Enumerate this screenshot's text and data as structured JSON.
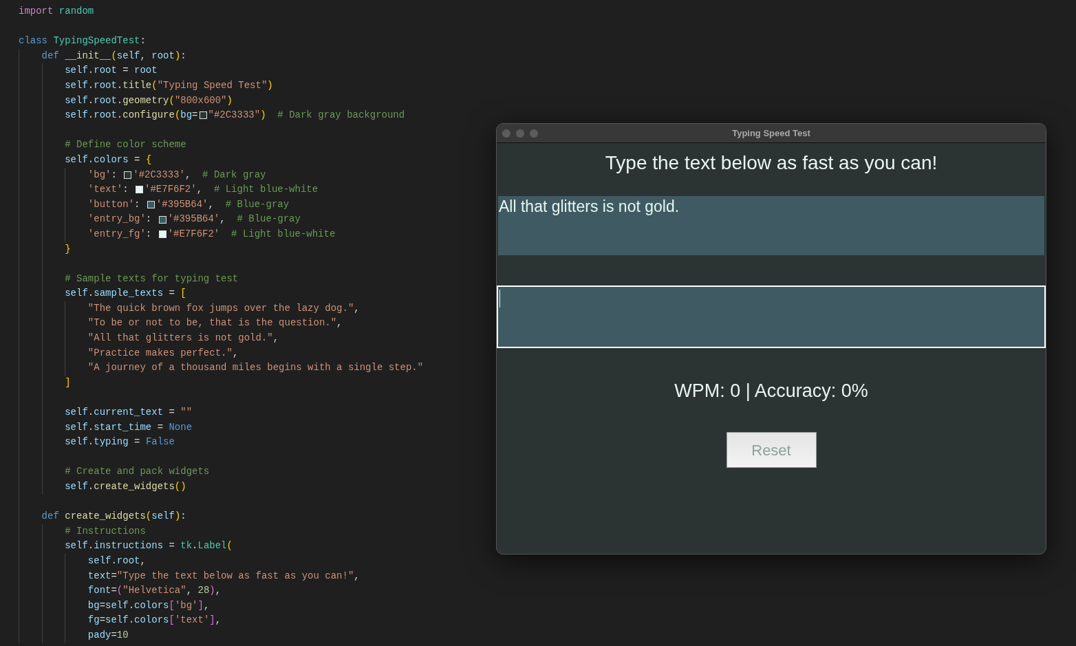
{
  "editor": {
    "lines": [
      {
        "tokens": [
          {
            "kind": "kw",
            "text": "import "
          },
          {
            "kind": "cls",
            "text": "random"
          }
        ]
      },
      {
        "kind": "blank"
      },
      {
        "tokens": [
          {
            "kind": "kw2",
            "text": "class "
          },
          {
            "kind": "cls",
            "text": "TypingSpeedTest"
          },
          {
            "kind": "plain",
            "text": ":"
          }
        ]
      },
      {
        "tokens": [
          {
            "kind": "kw2",
            "text": "    def "
          },
          {
            "kind": "fn",
            "text": "__init__"
          },
          {
            "kind": "br",
            "text": "("
          },
          {
            "kind": "var",
            "text": "self"
          },
          {
            "kind": "plain",
            "text": ", "
          },
          {
            "kind": "var",
            "text": "root"
          },
          {
            "kind": "br",
            "text": ")"
          },
          {
            "kind": "plain",
            "text": ":"
          }
        ]
      },
      {
        "tokens": [
          {
            "kind": "var",
            "text": "        self"
          },
          {
            "kind": "plain",
            "text": "."
          },
          {
            "kind": "var",
            "text": "root"
          },
          {
            "kind": "plain",
            "text": " = "
          },
          {
            "kind": "var",
            "text": "root"
          }
        ]
      },
      {
        "tokens": [
          {
            "kind": "var",
            "text": "        self"
          },
          {
            "kind": "plain",
            "text": "."
          },
          {
            "kind": "var",
            "text": "root"
          },
          {
            "kind": "plain",
            "text": "."
          },
          {
            "kind": "fn",
            "text": "title"
          },
          {
            "kind": "br",
            "text": "("
          },
          {
            "kind": "str",
            "text": "\"Typing Speed Test\""
          },
          {
            "kind": "br",
            "text": ")"
          }
        ]
      },
      {
        "tokens": [
          {
            "kind": "var",
            "text": "        self"
          },
          {
            "kind": "plain",
            "text": "."
          },
          {
            "kind": "var",
            "text": "root"
          },
          {
            "kind": "plain",
            "text": "."
          },
          {
            "kind": "fn",
            "text": "geometry"
          },
          {
            "kind": "br",
            "text": "("
          },
          {
            "kind": "str",
            "text": "\"800x600\""
          },
          {
            "kind": "br",
            "text": ")"
          }
        ]
      },
      {
        "tokens": [
          {
            "kind": "var",
            "text": "        self"
          },
          {
            "kind": "plain",
            "text": "."
          },
          {
            "kind": "var",
            "text": "root"
          },
          {
            "kind": "plain",
            "text": "."
          },
          {
            "kind": "fn",
            "text": "configure"
          },
          {
            "kind": "br",
            "text": "("
          },
          {
            "kind": "var",
            "text": "bg"
          },
          {
            "kind": "plain",
            "text": "="
          },
          {
            "kind": "swatch",
            "color": "#2c3333"
          },
          {
            "kind": "str",
            "text": "\"#2C3333\""
          },
          {
            "kind": "br",
            "text": ")"
          },
          {
            "kind": "com",
            "text": "  # Dark gray background"
          }
        ]
      },
      {
        "kind": "blank"
      },
      {
        "tokens": [
          {
            "kind": "com",
            "text": "        # Define color scheme"
          }
        ]
      },
      {
        "tokens": [
          {
            "kind": "var",
            "text": "        self"
          },
          {
            "kind": "plain",
            "text": "."
          },
          {
            "kind": "var",
            "text": "colors"
          },
          {
            "kind": "plain",
            "text": " = "
          },
          {
            "kind": "br",
            "text": "{"
          }
        ]
      },
      {
        "tokens": [
          {
            "kind": "str",
            "text": "            'bg'"
          },
          {
            "kind": "plain",
            "text": ": "
          },
          {
            "kind": "swatch",
            "color": "#2c3333"
          },
          {
            "kind": "str",
            "text": "'#2C3333'"
          },
          {
            "kind": "plain",
            "text": ",  "
          },
          {
            "kind": "com",
            "text": "# Dark gray"
          }
        ]
      },
      {
        "tokens": [
          {
            "kind": "str",
            "text": "            'text'"
          },
          {
            "kind": "plain",
            "text": ": "
          },
          {
            "kind": "swatch",
            "color": "#e7f6f2"
          },
          {
            "kind": "str",
            "text": "'#E7F6F2'"
          },
          {
            "kind": "plain",
            "text": ",  "
          },
          {
            "kind": "com",
            "text": "# Light blue-white"
          }
        ]
      },
      {
        "tokens": [
          {
            "kind": "str",
            "text": "            'button'"
          },
          {
            "kind": "plain",
            "text": ": "
          },
          {
            "kind": "swatch",
            "color": "#395b64"
          },
          {
            "kind": "str",
            "text": "'#395B64'"
          },
          {
            "kind": "plain",
            "text": ",  "
          },
          {
            "kind": "com",
            "text": "# Blue-gray"
          }
        ]
      },
      {
        "tokens": [
          {
            "kind": "str",
            "text": "            'entry_bg'"
          },
          {
            "kind": "plain",
            "text": ": "
          },
          {
            "kind": "swatch",
            "color": "#395b64"
          },
          {
            "kind": "str",
            "text": "'#395B64'"
          },
          {
            "kind": "plain",
            "text": ",  "
          },
          {
            "kind": "com",
            "text": "# Blue-gray"
          }
        ]
      },
      {
        "tokens": [
          {
            "kind": "str",
            "text": "            'entry_fg'"
          },
          {
            "kind": "plain",
            "text": ": "
          },
          {
            "kind": "swatch",
            "color": "#e7f6f2"
          },
          {
            "kind": "str",
            "text": "'#E7F6F2'"
          },
          {
            "kind": "com",
            "text": "  # Light blue-white"
          }
        ]
      },
      {
        "tokens": [
          {
            "kind": "br",
            "text": "        }"
          }
        ]
      },
      {
        "kind": "blank"
      },
      {
        "tokens": [
          {
            "kind": "com",
            "text": "        # Sample texts for typing test"
          }
        ]
      },
      {
        "tokens": [
          {
            "kind": "var",
            "text": "        self"
          },
          {
            "kind": "plain",
            "text": "."
          },
          {
            "kind": "var",
            "text": "sample_texts"
          },
          {
            "kind": "plain",
            "text": " = "
          },
          {
            "kind": "br",
            "text": "["
          }
        ]
      },
      {
        "tokens": [
          {
            "kind": "str",
            "text": "            \"The quick brown fox jumps over the lazy dog.\""
          },
          {
            "kind": "plain",
            "text": ","
          }
        ]
      },
      {
        "tokens": [
          {
            "kind": "str",
            "text": "            \"To be or not to be, that is the question.\""
          },
          {
            "kind": "plain",
            "text": ","
          }
        ]
      },
      {
        "tokens": [
          {
            "kind": "str",
            "text": "            \"All that glitters is not gold.\""
          },
          {
            "kind": "plain",
            "text": ","
          }
        ]
      },
      {
        "tokens": [
          {
            "kind": "str",
            "text": "            \"Practice makes perfect.\""
          },
          {
            "kind": "plain",
            "text": ","
          }
        ]
      },
      {
        "tokens": [
          {
            "kind": "str",
            "text": "            \"A journey of a thousand miles begins with a single step.\""
          }
        ]
      },
      {
        "tokens": [
          {
            "kind": "br",
            "text": "        ]"
          }
        ]
      },
      {
        "kind": "blank"
      },
      {
        "tokens": [
          {
            "kind": "var",
            "text": "        self"
          },
          {
            "kind": "plain",
            "text": "."
          },
          {
            "kind": "var",
            "text": "current_text"
          },
          {
            "kind": "plain",
            "text": " = "
          },
          {
            "kind": "str",
            "text": "\"\""
          }
        ]
      },
      {
        "tokens": [
          {
            "kind": "var",
            "text": "        self"
          },
          {
            "kind": "plain",
            "text": "."
          },
          {
            "kind": "var",
            "text": "start_time"
          },
          {
            "kind": "plain",
            "text": " = "
          },
          {
            "kind": "kw2",
            "text": "None"
          }
        ]
      },
      {
        "tokens": [
          {
            "kind": "var",
            "text": "        self"
          },
          {
            "kind": "plain",
            "text": "."
          },
          {
            "kind": "var",
            "text": "typing"
          },
          {
            "kind": "plain",
            "text": " = "
          },
          {
            "kind": "kw2",
            "text": "False"
          }
        ]
      },
      {
        "kind": "blank"
      },
      {
        "tokens": [
          {
            "kind": "com",
            "text": "        # Create and pack widgets"
          }
        ]
      },
      {
        "tokens": [
          {
            "kind": "var",
            "text": "        self"
          },
          {
            "kind": "plain",
            "text": "."
          },
          {
            "kind": "fn",
            "text": "create_widgets"
          },
          {
            "kind": "br",
            "text": "()"
          }
        ]
      },
      {
        "kind": "blank"
      },
      {
        "tokens": [
          {
            "kind": "kw2",
            "text": "    def "
          },
          {
            "kind": "fn",
            "text": "create_widgets"
          },
          {
            "kind": "br",
            "text": "("
          },
          {
            "kind": "var",
            "text": "self"
          },
          {
            "kind": "br",
            "text": ")"
          },
          {
            "kind": "plain",
            "text": ":"
          }
        ]
      },
      {
        "tokens": [
          {
            "kind": "com",
            "text": "        # Instructions"
          }
        ]
      },
      {
        "tokens": [
          {
            "kind": "var",
            "text": "        self"
          },
          {
            "kind": "plain",
            "text": "."
          },
          {
            "kind": "var",
            "text": "instructions"
          },
          {
            "kind": "plain",
            "text": " = "
          },
          {
            "kind": "cls",
            "text": "tk"
          },
          {
            "kind": "plain",
            "text": "."
          },
          {
            "kind": "cls",
            "text": "Label"
          },
          {
            "kind": "br",
            "text": "("
          }
        ]
      },
      {
        "tokens": [
          {
            "kind": "var",
            "text": "            self"
          },
          {
            "kind": "plain",
            "text": "."
          },
          {
            "kind": "var",
            "text": "root"
          },
          {
            "kind": "plain",
            "text": ","
          }
        ]
      },
      {
        "tokens": [
          {
            "kind": "var",
            "text": "            text"
          },
          {
            "kind": "plain",
            "text": "="
          },
          {
            "kind": "str",
            "text": "\"Type the text below as fast as you can!\""
          },
          {
            "kind": "plain",
            "text": ","
          }
        ]
      },
      {
        "tokens": [
          {
            "kind": "var",
            "text": "            font"
          },
          {
            "kind": "plain",
            "text": "="
          },
          {
            "kind": "br2",
            "text": "("
          },
          {
            "kind": "str",
            "text": "\"Helvetica\""
          },
          {
            "kind": "plain",
            "text": ", "
          },
          {
            "kind": "num",
            "text": "28"
          },
          {
            "kind": "br2",
            "text": ")"
          },
          {
            "kind": "plain",
            "text": ","
          }
        ]
      },
      {
        "tokens": [
          {
            "kind": "var",
            "text": "            bg"
          },
          {
            "kind": "plain",
            "text": "="
          },
          {
            "kind": "var",
            "text": "self"
          },
          {
            "kind": "plain",
            "text": "."
          },
          {
            "kind": "var",
            "text": "colors"
          },
          {
            "kind": "br2",
            "text": "["
          },
          {
            "kind": "str",
            "text": "'bg'"
          },
          {
            "kind": "br2",
            "text": "]"
          },
          {
            "kind": "plain",
            "text": ","
          }
        ]
      },
      {
        "tokens": [
          {
            "kind": "var",
            "text": "            fg"
          },
          {
            "kind": "plain",
            "text": "="
          },
          {
            "kind": "var",
            "text": "self"
          },
          {
            "kind": "plain",
            "text": "."
          },
          {
            "kind": "var",
            "text": "colors"
          },
          {
            "kind": "br2",
            "text": "["
          },
          {
            "kind": "str",
            "text": "'text'"
          },
          {
            "kind": "br2",
            "text": "]"
          },
          {
            "kind": "plain",
            "text": ","
          }
        ]
      },
      {
        "tokens": [
          {
            "kind": "var",
            "text": "            pady"
          },
          {
            "kind": "plain",
            "text": "="
          },
          {
            "kind": "num",
            "text": "10"
          }
        ]
      }
    ]
  },
  "app_window": {
    "title": "Typing Speed Test",
    "heading": "Type the text below as fast as you can!",
    "sample_text": "All that glitters is not gold.",
    "entry": {
      "focused": true
    },
    "stats": "WPM: 0 | Accuracy: 0%",
    "button": "Reset"
  }
}
